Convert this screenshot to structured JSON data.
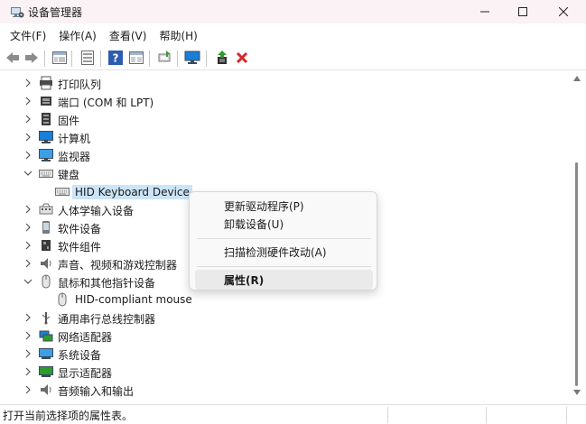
{
  "window": {
    "title": "设备管理器",
    "controls": {
      "minimize": "—",
      "maximize": "☐",
      "close": "✕"
    }
  },
  "menu": {
    "items": [
      "文件(F)",
      "操作(A)",
      "查看(V)",
      "帮助(H)"
    ]
  },
  "toolbar": {
    "icons": [
      "back-icon",
      "forward-icon",
      "properties-pane-icon",
      "show-hide-icon",
      "help-icon",
      "view-icon",
      "scan-icon",
      "monitor-icon",
      "update-driver-icon",
      "uninstall-icon"
    ]
  },
  "tree": {
    "rows": [
      {
        "label": "打印队列",
        "expander": "collapsed",
        "icon": "printer-icon"
      },
      {
        "label": "端口 (COM 和 LPT)",
        "expander": "collapsed",
        "icon": "port-icon"
      },
      {
        "label": "固件",
        "expander": "collapsed",
        "icon": "firmware-icon"
      },
      {
        "label": "计算机",
        "expander": "collapsed",
        "icon": "computer-icon"
      },
      {
        "label": "监视器",
        "expander": "collapsed",
        "icon": "monitor-icon"
      },
      {
        "label": "键盘",
        "expander": "expanded",
        "icon": "keyboard-icon"
      },
      {
        "label": "HID Keyboard Device",
        "expander": "none",
        "icon": "keyboard-icon",
        "selected": true
      },
      {
        "label": "人体学输入设备",
        "expander": "collapsed",
        "icon": "hid-icon"
      },
      {
        "label": "软件设备",
        "expander": "collapsed",
        "icon": "software-device-icon"
      },
      {
        "label": "软件组件",
        "expander": "collapsed",
        "icon": "software-component-icon"
      },
      {
        "label": "声音、视频和游戏控制器",
        "expander": "collapsed",
        "icon": "speaker-icon"
      },
      {
        "label": "鼠标和其他指针设备",
        "expander": "expanded",
        "icon": "mouse-icon"
      },
      {
        "label": "HID-compliant mouse",
        "expander": "none",
        "icon": "mouse-icon"
      },
      {
        "label": "通用串行总线控制器",
        "expander": "collapsed",
        "icon": "usb-icon"
      },
      {
        "label": "网络适配器",
        "expander": "collapsed",
        "icon": "network-icon"
      },
      {
        "label": "系统设备",
        "expander": "collapsed",
        "icon": "system-device-icon"
      },
      {
        "label": "显示适配器",
        "expander": "collapsed",
        "icon": "display-adapter-icon"
      },
      {
        "label": "音频输入和输出",
        "expander": "collapsed",
        "icon": "audio-icon"
      }
    ]
  },
  "context_menu": {
    "items": [
      {
        "label": "更新驱动程序(P)"
      },
      {
        "label": "卸载设备(U)"
      },
      {
        "label": "扫描检测硬件改动(A)"
      },
      {
        "label": "属性(R)",
        "bold": true,
        "highlighted": true
      }
    ]
  },
  "status": {
    "text": "打开当前选择项的属性表。"
  },
  "colors": {
    "titlebar_bg": "#fbf2f5",
    "selection": "#cce4f7",
    "uninstall_red": "#d9262a",
    "help_blue": "#2a5db0",
    "monitor_blue": "#1a7fd6"
  }
}
